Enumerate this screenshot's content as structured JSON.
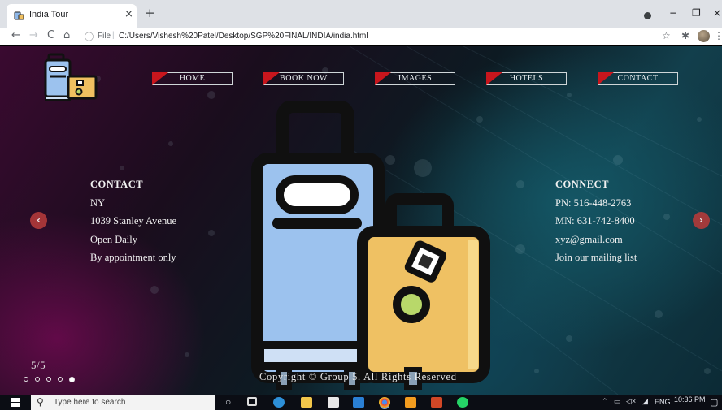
{
  "browser": {
    "tab_title": "India Tour",
    "tab_close": "×",
    "new_tab": "+",
    "url_scheme": "File",
    "url_separator": "|",
    "url": "C:/Users/Vishesh%20Patel/Desktop/SGP%20FINAL/INDIA/india.html",
    "window_controls": {
      "minimize": "−",
      "maximize": "❐",
      "close": "×"
    },
    "nav": {
      "back": "←",
      "forward": "→",
      "reload": "C",
      "home": "⌂"
    }
  },
  "site": {
    "nav_links": [
      "HOME",
      "BOOK NOW",
      "IMAGES",
      "HOTELS",
      "CONTACT"
    ],
    "contact": {
      "heading": "CONTACT",
      "lines": [
        "NY",
        "1039 Stanley Avenue",
        "Open Daily",
        "By appointment only"
      ]
    },
    "connect": {
      "heading": "CONNECT",
      "lines": [
        "PN: 516-448-2763",
        "MN: 631-742-8400",
        "xyz@gmail.com",
        "Join our mailing list"
      ]
    },
    "slider": {
      "counter": "5/5",
      "total": 5,
      "active_index": 5,
      "prev_arrow": "‹",
      "next_arrow": "›"
    },
    "copyright": "Copyright © Group 5. All Rights Reserved",
    "colors": {
      "nav_accent": "#c8161d",
      "arrow_button": "#b23a3a"
    }
  },
  "taskbar": {
    "search_placeholder": "Type here to search",
    "language": "ENG",
    "time": "10:36 PM",
    "tray_icons": [
      "chevron-up-icon",
      "battery-icon",
      "volume-icon",
      "network-icon"
    ],
    "apps": [
      "task-view-icon",
      "edge-icon",
      "file-explorer-icon",
      "store-icon",
      "mail-icon",
      "chrome-icon",
      "sublime-icon",
      "powerpoint-icon",
      "whatsapp-icon"
    ]
  }
}
